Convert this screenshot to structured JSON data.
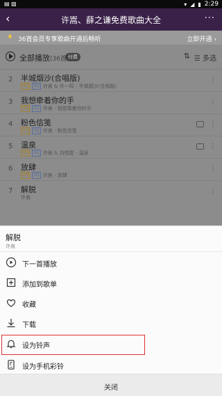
{
  "status_bar": {
    "left_icons": "▤ ▨",
    "time": "2:29"
  },
  "header": {
    "back_icon": "back-arrow-icon",
    "title": "许嵩、薛之谦免费歌曲大全",
    "more_icon": "more-icon"
  },
  "banner": {
    "text": "36首会员专享歌曲开通后畅听",
    "action": "立即开通 ›"
  },
  "play_all": {
    "label": "全部播放",
    "count": "(36首)",
    "badge": "付费",
    "multi_select": "多选"
  },
  "songs": [
    {
      "num": "2",
      "title": "半城烟沙(合唱版)",
      "meta": "许嵩 & 许一鸣 - 半城烟沙(合唱版)",
      "tags": [
        "HQ",
        "SQ"
      ]
    },
    {
      "num": "3",
      "title": "我想牵着你的手",
      "meta": "许嵩 - 我想牵着你的手",
      "tags": [
        "HQ",
        "SQ"
      ]
    },
    {
      "num": "4",
      "title": "粉色信笺",
      "meta": "许嵩 - 粉色信笺",
      "tags": [
        "HQ",
        "SQ"
      ]
    },
    {
      "num": "5",
      "title": "温泉",
      "meta": "许嵩 & 刘惜君 - 温泉",
      "tags": [
        "HQ",
        "SQ"
      ]
    },
    {
      "num": "6",
      "title": "放肆",
      "meta": "许嵩 - 放肆",
      "tags": [
        "HQ",
        "SQ"
      ]
    },
    {
      "num": "7",
      "title": "解脱",
      "meta": "许嵩",
      "tags": []
    }
  ],
  "sheet": {
    "title": "解脱",
    "subtitle": "许嵩",
    "items": [
      {
        "label": "下一首播放",
        "icon": "play-next-icon"
      },
      {
        "label": "添加到歌单",
        "icon": "add-to-playlist-icon"
      },
      {
        "label": "收藏",
        "icon": "heart-icon"
      },
      {
        "label": "下载",
        "icon": "download-icon"
      },
      {
        "label": "设为铃声",
        "icon": "bell-icon"
      },
      {
        "label": "设为手机彩铃",
        "icon": "phone-ringtone-icon"
      }
    ],
    "close_label": "关闭"
  },
  "colors": {
    "header": "#3a2148",
    "highlight": "#e03030"
  }
}
